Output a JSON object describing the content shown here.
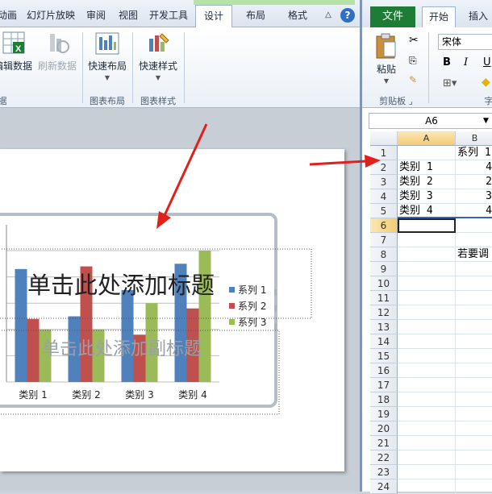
{
  "powerpoint": {
    "tabs": [
      "动画",
      "幻灯片放映",
      "审阅",
      "视图",
      "开发工具",
      "设计",
      "布局",
      "格式"
    ],
    "active_tab": "设计",
    "ribbon": {
      "edit_data": "编辑数据",
      "refresh_data": "刷新数据",
      "quick_layout": "快速布局",
      "quick_style": "快速样式",
      "group_chart_layout": "图表布局",
      "group_chart_style": "图表样式"
    },
    "chart": {
      "title_placeholder": "单击此处添加标题",
      "subtitle_placeholder": "单击此处添加副标题"
    }
  },
  "excel": {
    "file_tab": "文件",
    "tabs": [
      "开始",
      "插入"
    ],
    "ribbon": {
      "paste": "粘贴",
      "clipboard_group": "剪贴板",
      "font_name": "宋体",
      "bold": "B",
      "italic": "I",
      "underline": "U"
    },
    "name_box": "A6",
    "columns": [
      "A",
      "B"
    ],
    "rows": [
      "1",
      "2",
      "3",
      "4",
      "5",
      "6",
      "7",
      "8",
      "9",
      "10",
      "11",
      "12",
      "13",
      "14",
      "15",
      "16",
      "17",
      "18",
      "19",
      "20",
      "21",
      "22",
      "23",
      "24"
    ],
    "cells": {
      "B1": "系列 1",
      "A2": "类别 1",
      "B2": "4",
      "A3": "类别 2",
      "B3": "2",
      "A4": "类别 3",
      "B4": "3",
      "A5": "类别 4",
      "B5": "4",
      "B8": "若要调"
    }
  },
  "chart_data": {
    "type": "bar",
    "categories": [
      "类别 1",
      "类别 2",
      "类别 3",
      "类别 4"
    ],
    "series": [
      {
        "name": "系列 1",
        "values": [
          4.3,
          2.5,
          3.5,
          4.5
        ]
      },
      {
        "name": "系列 2",
        "values": [
          2.4,
          4.4,
          1.8,
          2.8
        ]
      },
      {
        "name": "系列 3",
        "values": [
          2.0,
          2.0,
          3.0,
          5.0
        ]
      }
    ],
    "ylim": [
      0,
      5
    ],
    "legend": "right",
    "grid": true,
    "colors": [
      "#4f81bd",
      "#c0504d",
      "#9bbb59"
    ]
  },
  "colors": {
    "excel_green": "#1e7c36",
    "annotation_arrow": "#e0201b"
  }
}
